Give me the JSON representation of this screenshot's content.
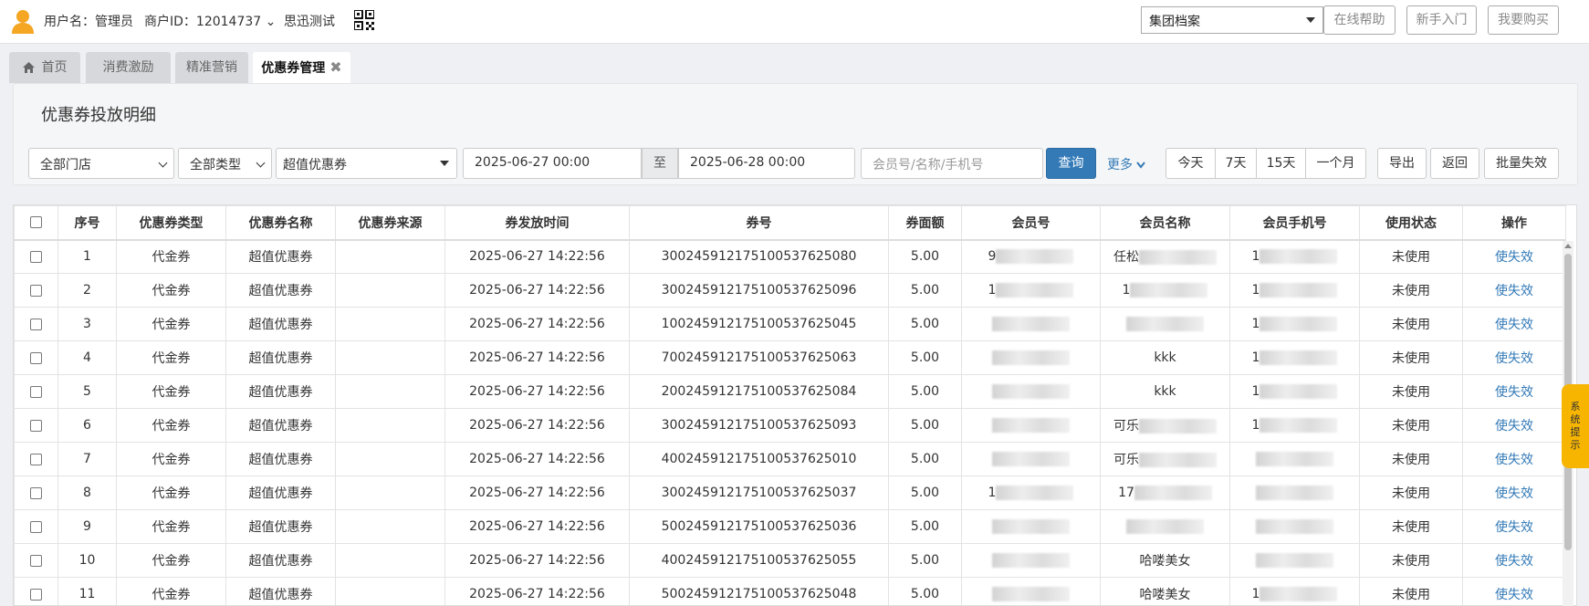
{
  "header": {
    "username_label": "用户名：管理员",
    "merchant_label": "商户ID：12014737",
    "merchant_chevron": "⌄",
    "company": "思迅测试",
    "group_select": "集团档案",
    "help_button": "在线帮助",
    "guide_button": "新手入门",
    "buy_button": "我要购买"
  },
  "tabs": [
    {
      "label": "首页",
      "icon": "home-icon"
    },
    {
      "label": "消费激励"
    },
    {
      "label": "精准营销"
    },
    {
      "label": "优惠券管理",
      "active": true,
      "close": "✖"
    }
  ],
  "panel": {
    "title": "优惠券投放明细",
    "store_select": "全部门店",
    "type_select": "全部类型",
    "coupon_select": "超值优惠券",
    "date_from": "2025-06-27 00:00",
    "date_sep": "至",
    "date_to": "2025-06-28 00:00",
    "member_placeholder": "会员号/名称/手机号",
    "query_button": "查询",
    "more_link": "更多",
    "quick_ranges": [
      "今天",
      "7天",
      "15天",
      "一个月"
    ],
    "export_button": "导出",
    "back_button": "返回",
    "batch_invalid_button": "批量失效"
  },
  "table": {
    "columns": [
      "序号",
      "优惠券类型",
      "优惠券名称",
      "优惠券来源",
      "券发放时间",
      "券号",
      "券面额",
      "会员号",
      "会员名称",
      "会员手机号",
      "使用状态",
      "操作"
    ],
    "rows": [
      {
        "no": "1",
        "type": "代金券",
        "name": "超值优惠券",
        "source": "",
        "time": "2025-06-27 14:22:56",
        "code": "300245912175100537625080",
        "amount": "5.00",
        "member_no": "9",
        "member_name": "任松",
        "phone": "1",
        "status": "未使用",
        "action": "使失效"
      },
      {
        "no": "2",
        "type": "代金券",
        "name": "超值优惠券",
        "source": "",
        "time": "2025-06-27 14:22:56",
        "code": "300245912175100537625096",
        "amount": "5.00",
        "member_no": "1",
        "member_name": "1",
        "phone": "1",
        "status": "未使用",
        "action": "使失效"
      },
      {
        "no": "3",
        "type": "代金券",
        "name": "超值优惠券",
        "source": "",
        "time": "2025-06-27 14:22:56",
        "code": "100245912175100537625045",
        "amount": "5.00",
        "member_no": "",
        "member_name": "",
        "phone": "1",
        "status": "未使用",
        "action": "使失效"
      },
      {
        "no": "4",
        "type": "代金券",
        "name": "超值优惠券",
        "source": "",
        "time": "2025-06-27 14:22:56",
        "code": "700245912175100537625063",
        "amount": "5.00",
        "member_no": "",
        "member_name": "kkk",
        "phone": "1",
        "status": "未使用",
        "action": "使失效"
      },
      {
        "no": "5",
        "type": "代金券",
        "name": "超值优惠券",
        "source": "",
        "time": "2025-06-27 14:22:56",
        "code": "200245912175100537625084",
        "amount": "5.00",
        "member_no": "",
        "member_name": "kkk",
        "phone": "1",
        "status": "未使用",
        "action": "使失效"
      },
      {
        "no": "6",
        "type": "代金券",
        "name": "超值优惠券",
        "source": "",
        "time": "2025-06-27 14:22:56",
        "code": "300245912175100537625093",
        "amount": "5.00",
        "member_no": "",
        "member_name": "可乐",
        "phone": "1",
        "status": "未使用",
        "action": "使失效"
      },
      {
        "no": "7",
        "type": "代金券",
        "name": "超值优惠券",
        "source": "",
        "time": "2025-06-27 14:22:56",
        "code": "400245912175100537625010",
        "amount": "5.00",
        "member_no": "",
        "member_name": "可乐",
        "phone": "",
        "status": "未使用",
        "action": "使失效"
      },
      {
        "no": "8",
        "type": "代金券",
        "name": "超值优惠券",
        "source": "",
        "time": "2025-06-27 14:22:56",
        "code": "300245912175100537625037",
        "amount": "5.00",
        "member_no": "1",
        "member_name": "17",
        "phone": "",
        "status": "未使用",
        "action": "使失效"
      },
      {
        "no": "9",
        "type": "代金券",
        "name": "超值优惠券",
        "source": "",
        "time": "2025-06-27 14:22:56",
        "code": "500245912175100537625036",
        "amount": "5.00",
        "member_no": "",
        "member_name": "",
        "phone": "",
        "status": "未使用",
        "action": "使失效"
      },
      {
        "no": "10",
        "type": "代金券",
        "name": "超值优惠券",
        "source": "",
        "time": "2025-06-27 14:22:56",
        "code": "400245912175100537625055",
        "amount": "5.00",
        "member_no": "",
        "member_name": "哈喽美女",
        "phone": "",
        "status": "未使用",
        "action": "使失效"
      },
      {
        "no": "11",
        "type": "代金券",
        "name": "超值优惠券",
        "source": "",
        "time": "2025-06-27 14:22:56",
        "code": "500245912175100537625048",
        "amount": "5.00",
        "member_no": "",
        "member_name": "哈喽美女",
        "phone": "1",
        "status": "未使用",
        "action": "使失效"
      }
    ]
  },
  "side_tip": "系统提示",
  "colors": {
    "primary": "#337ab7",
    "tip": "#f7b500",
    "avatar": "#f5a623"
  }
}
